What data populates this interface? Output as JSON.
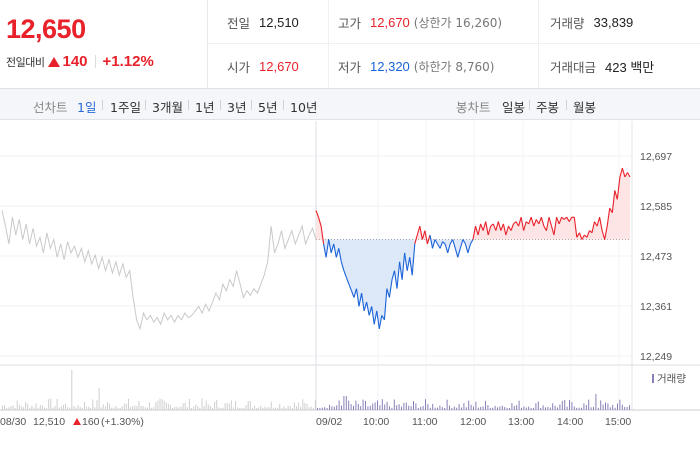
{
  "quote": {
    "price": "12,650",
    "change_label": "전일대비",
    "change_amount": "140",
    "change_rate": "+1.12%"
  },
  "stats": {
    "prev_close_label": "전일",
    "prev_close": "12,510",
    "high_label": "고가",
    "high": "12,670",
    "upper_limit_label": "(상한가 16,260)",
    "volume_label": "거래량",
    "volume": "33,839",
    "open_label": "시가",
    "open": "12,670",
    "low_label": "저가",
    "low": "12,320",
    "lower_limit_label": "(하한가 8,760)",
    "trade_value_label": "거래대금",
    "trade_value": "423 백만"
  },
  "period_bar": {
    "line_label": "선차트",
    "line_tabs": [
      "1일",
      "1주일",
      "3개월",
      "1년",
      "3년",
      "5년",
      "10년"
    ],
    "active_tab": "1일",
    "candle_label": "봉차트",
    "candle_tabs": [
      "일봉",
      "주봉",
      "월봉"
    ]
  },
  "colors": {
    "up": "#e8212a",
    "down": "#1a63d8",
    "prev_day_line": "#c9c9c9",
    "active_tab": "#2b6ad9",
    "volume": "#8b7fb8"
  },
  "chart_data": {
    "type": "line",
    "y_ticks": [
      "12,697",
      "12,585",
      "12,473",
      "12,361",
      "12,249"
    ],
    "ylim": [
      12249,
      12697
    ],
    "baseline": 12510,
    "x_labels": [
      "09/02",
      "10:00",
      "11:00",
      "12:00",
      "13:00",
      "14:00",
      "15:00"
    ],
    "volume_legend": "거래량",
    "prev_day_label": "08/30",
    "prev_day_close": "12,510",
    "prev_day_change": "160",
    "prev_day_rate": "(+1.30%)",
    "prev_day_series": [
      12575,
      12540,
      12500,
      12560,
      12520,
      12555,
      12510,
      12545,
      12500,
      12535,
      12495,
      12515,
      12480,
      12525,
      12490,
      12510,
      12470,
      12500,
      12465,
      12505,
      12480,
      12495,
      12470,
      12490,
      12460,
      12485,
      12455,
      12475,
      12445,
      12470,
      12440,
      12465,
      12435,
      12460,
      12430,
      12455,
      12425,
      12440,
      12380,
      12330,
      12310,
      12345,
      12330,
      12340,
      12325,
      12335,
      12320,
      12345,
      12330,
      12340,
      12325,
      12340,
      12330,
      12345,
      12335,
      12340,
      12350,
      12360,
      12345,
      12365,
      12350,
      12370,
      12390,
      12375,
      12410,
      12395,
      12420,
      12405,
      12440,
      12410,
      12380,
      12395,
      12385,
      12400,
      12390,
      12410,
      12430,
      12460,
      12540,
      12480,
      12500,
      12530,
      12490,
      12510,
      12530,
      12500,
      12520,
      12540,
      12500,
      12520,
      12535,
      12510
    ],
    "today_series": [
      12575,
      12560,
      12540,
      12500,
      12470,
      12510,
      12480,
      12500,
      12470,
      12490,
      12460,
      12440,
      12425,
      12410,
      12395,
      12380,
      12400,
      12360,
      12390,
      12350,
      12370,
      12340,
      12360,
      12320,
      12350,
      12310,
      12340,
      12330,
      12400,
      12380,
      12420,
      12440,
      12400,
      12460,
      12420,
      12480,
      12440,
      12470,
      12430,
      12500,
      12520,
      12540,
      12510,
      12530,
      12500,
      12520,
      12490,
      12510,
      12500,
      12490,
      12505,
      12500,
      12480,
      12500,
      12510,
      12490,
      12470,
      12490,
      12510,
      12500,
      12480,
      12500,
      12510,
      12540,
      12520,
      12545,
      12530,
      12550,
      12520,
      12540,
      12545,
      12530,
      12550,
      12530,
      12545,
      12520,
      12540,
      12530,
      12545,
      12550,
      12540,
      12560,
      12530,
      12550,
      12545,
      12560,
      12540,
      12555,
      12545,
      12560,
      12540,
      12530,
      12560,
      12540,
      12520,
      12560,
      12545,
      12560,
      12555,
      12560,
      12550,
      12560,
      12560,
      12515,
      12525,
      12510,
      12520,
      12515,
      12530,
      12525,
      12550,
      12540,
      12560,
      12530,
      12510,
      12540,
      12580,
      12570,
      12620,
      12600,
      12650,
      12670,
      12650,
      12660,
      12650
    ]
  }
}
